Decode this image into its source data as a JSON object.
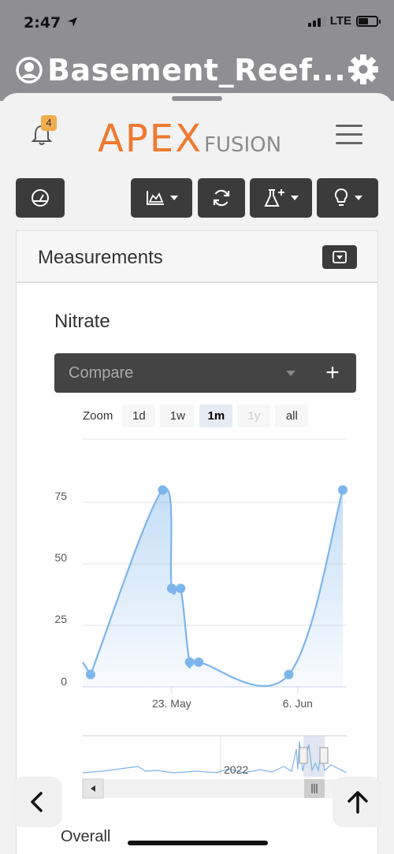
{
  "status_bar": {
    "time": "2:47",
    "network": "LTE"
  },
  "app": {
    "title": "Basement_Reef..."
  },
  "header": {
    "notification_count": "4",
    "logo_main": "APEX",
    "logo_sub": "FUSION"
  },
  "panel": {
    "title": "Measurements"
  },
  "chart": {
    "title": "Nitrate",
    "compare_placeholder": "Compare",
    "compare_add": "+",
    "zoom_label": "Zoom",
    "zoom_options": [
      "1d",
      "1w",
      "1m",
      "1y",
      "all"
    ],
    "zoom_active": "1m",
    "zoom_disabled": "1y",
    "navigator_label": "2022"
  },
  "chart_data": {
    "type": "area",
    "title": "Nitrate",
    "yticks": [
      0,
      25,
      50,
      75
    ],
    "xticks": [
      "23. May",
      "6. Jun"
    ],
    "ylim": [
      0,
      100
    ],
    "series": [
      {
        "x": [
          "2022-05-14",
          "2022-05-22",
          "2022-05-23",
          "2022-05-24",
          "2022-05-25",
          "2022-05-26",
          "2022-06-05",
          "2022-06-11"
        ],
        "values": [
          5,
          80,
          40,
          40,
          10,
          10,
          5,
          80
        ]
      }
    ],
    "line_color": "#7cb5ec",
    "grid": true
  },
  "footer": {
    "overall_label": "Overall",
    "back_label": "<"
  }
}
